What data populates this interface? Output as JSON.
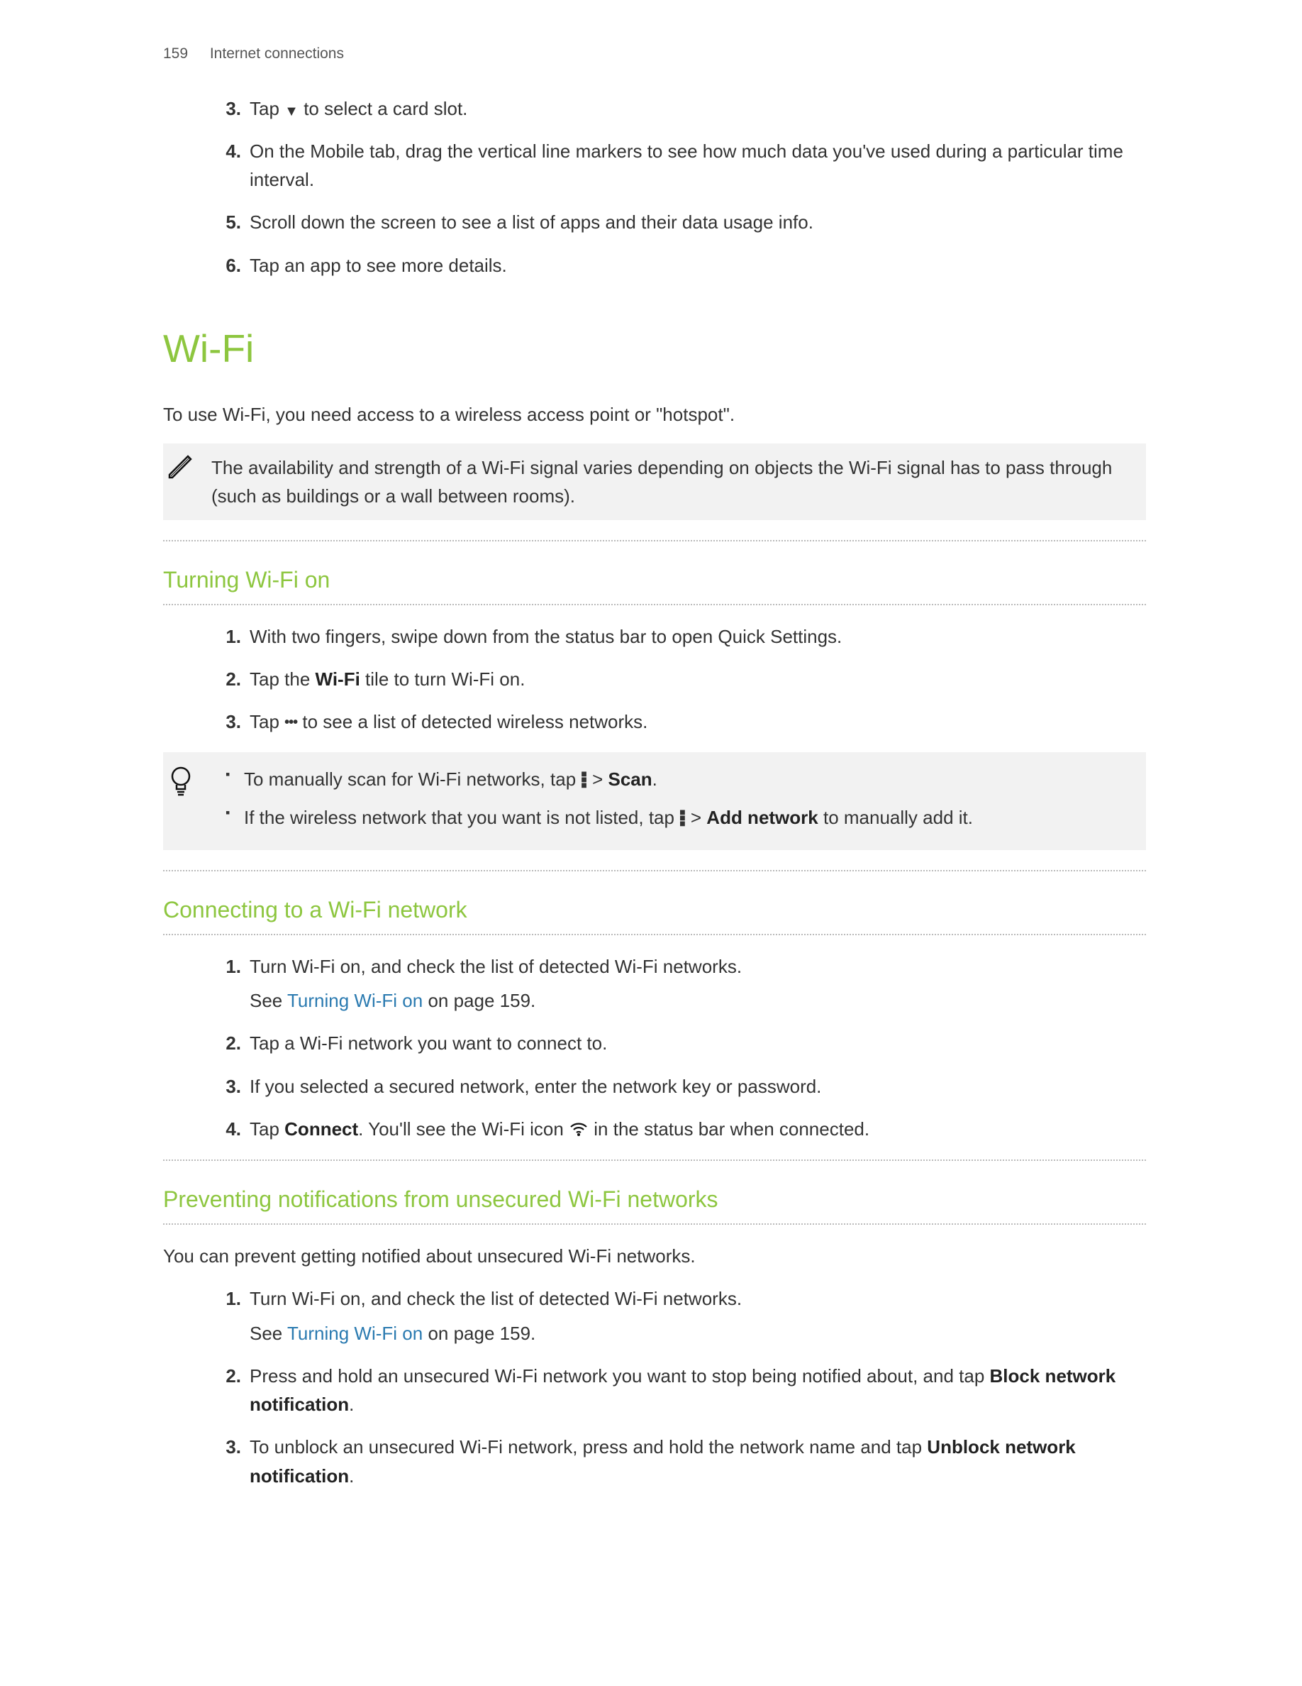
{
  "header": {
    "page": "159",
    "section": "Internet connections"
  },
  "top_list": {
    "start": 3,
    "items": [
      {
        "pre": "Tap ",
        "icon": "dropdown",
        "post": " to select a card slot."
      },
      {
        "text": "On the Mobile tab, drag the vertical line markers to see how much data you've used during a particular time interval."
      },
      {
        "text": "Scroll down the screen to see a list of apps and their data usage info."
      },
      {
        "text": "Tap an app to see more details."
      }
    ]
  },
  "h1": "Wi-Fi",
  "intro": "To use Wi-Fi, you need access to a wireless access point or \"hotspot\".",
  "note": "The availability and strength of a Wi-Fi signal varies depending on objects the Wi-Fi signal has to pass through (such as buildings or a wall between rooms).",
  "sect1": {
    "title": "Turning Wi-Fi on",
    "items": [
      {
        "text": "With two fingers, swipe down from the status bar to open Quick Settings."
      },
      {
        "pre": "Tap the ",
        "bold": "Wi-Fi",
        "post": " tile to turn Wi-Fi on."
      },
      {
        "pre": "Tap ",
        "icon": "hdots",
        "post": " to see a list of detected wireless networks."
      }
    ]
  },
  "tip": {
    "b1": {
      "pre": "To manually scan for Wi-Fi networks, tap ",
      "post1": " > ",
      "bold": "Scan",
      "post2": "."
    },
    "b2": {
      "pre": "If the wireless network that you want is not listed, tap ",
      "post1": " > ",
      "bold": "Add network",
      "post2": " to manually add it."
    }
  },
  "sect2": {
    "title": "Connecting to a Wi-Fi network",
    "items": {
      "i1": {
        "l1": "Turn Wi-Fi on, and check the list of detected Wi-Fi networks.",
        "see": "See ",
        "link": "Turning Wi-Fi on",
        "after": " on page 159."
      },
      "i2": "Tap a Wi-Fi network you want to connect to.",
      "i3": "If you selected a secured network, enter the network key or password.",
      "i4": {
        "pre": "Tap ",
        "bold": "Connect",
        "mid": ". You'll see the Wi-Fi icon ",
        "post": " in the status bar when connected."
      }
    }
  },
  "sect3": {
    "title": "Preventing notifications from unsecured Wi-Fi networks",
    "intro": "You can prevent getting notified about unsecured Wi-Fi networks.",
    "items": {
      "i1": {
        "l1": "Turn Wi-Fi on, and check the list of detected Wi-Fi networks.",
        "see": "See ",
        "link": "Turning Wi-Fi on",
        "after": " on page 159."
      },
      "i2": {
        "pre": "Press and hold an unsecured Wi-Fi network you want to stop being notified about, and tap ",
        "bold": "Block network notification",
        "post": "."
      },
      "i3": {
        "pre": "To unblock an unsecured Wi-Fi network, press and hold the network name and tap ",
        "bold": "Unblock network notification",
        "post": "."
      }
    }
  }
}
